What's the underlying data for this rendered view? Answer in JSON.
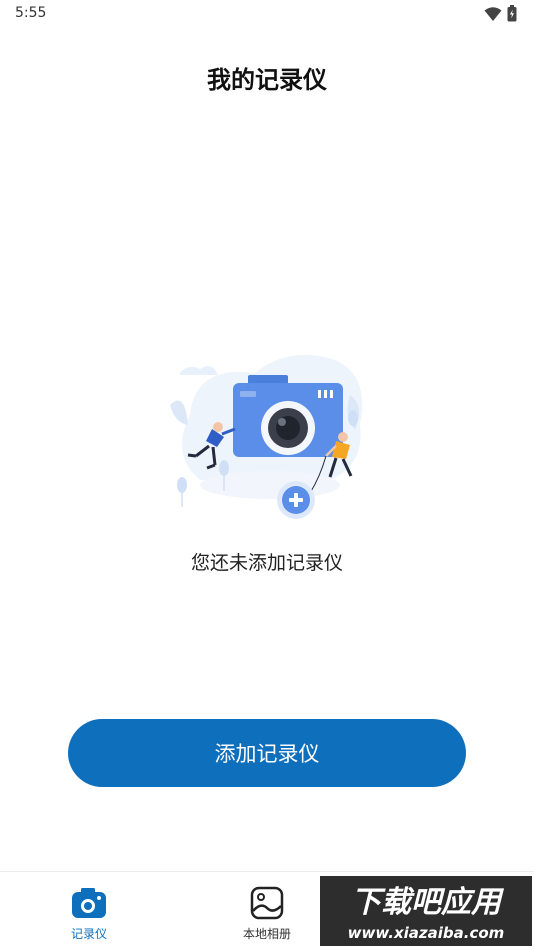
{
  "status_bar": {
    "time": "5:55",
    "icons": [
      "wifi-icon",
      "battery-icon"
    ]
  },
  "header": {
    "title": "我的记录仪"
  },
  "empty_state": {
    "illustration": "camera-illustration",
    "message": "您还未添加记录仪"
  },
  "actions": {
    "add_button_label": "添加记录仪"
  },
  "bottom_nav": {
    "items": [
      {
        "label": "记录仪",
        "icon": "camera-icon",
        "active": true
      },
      {
        "label": "本地相册",
        "icon": "album-icon",
        "active": false
      }
    ]
  },
  "watermark": {
    "line1": "下载吧应用",
    "line2": "www.xiazaiba.com"
  },
  "colors": {
    "accent": "#0e6fbd",
    "camera_body": "#5b8ee8",
    "watermark_bg": "#2d2d2d"
  }
}
